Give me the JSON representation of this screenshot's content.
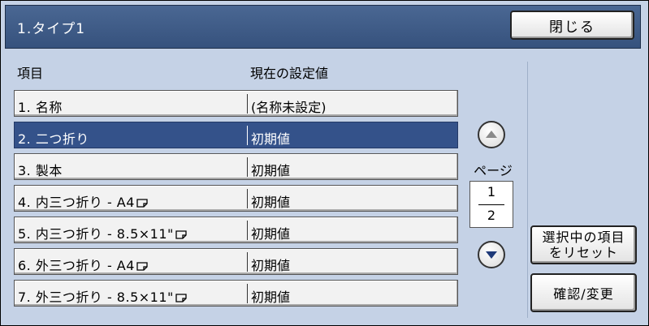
{
  "window": {
    "title": "1.タイプ1",
    "close_label": "閉じる"
  },
  "headers": {
    "item": "項目",
    "current_value": "現在の設定値"
  },
  "rows": [
    {
      "item": "1. 名称",
      "value": "(名称未設定)",
      "selected": false
    },
    {
      "item": "2. 二つ折り",
      "value": "初期値",
      "selected": true
    },
    {
      "item": "3. 製本",
      "value": "初期値",
      "selected": false
    },
    {
      "item": "4. 内三つ折り - A4",
      "value": "初期値",
      "selected": false
    },
    {
      "item": "5. 内三つ折り - 8.5×11\"",
      "value": "初期値",
      "selected": false
    },
    {
      "item": "6. 外三つ折り - A4",
      "value": "初期値",
      "selected": false
    },
    {
      "item": "7. 外三つ折り - 8.5×11\"",
      "value": "初期値",
      "selected": false
    }
  ],
  "pager": {
    "label": "ページ",
    "current": "1",
    "total": "2"
  },
  "buttons": {
    "reset_line1": "選択中の項目",
    "reset_line2": "をリセット",
    "confirm": "確認/変更"
  },
  "icons": {
    "page_up": "arrow-up-icon",
    "page_down": "arrow-down-icon",
    "paper_orientation": "landscape-paper-icon"
  }
}
